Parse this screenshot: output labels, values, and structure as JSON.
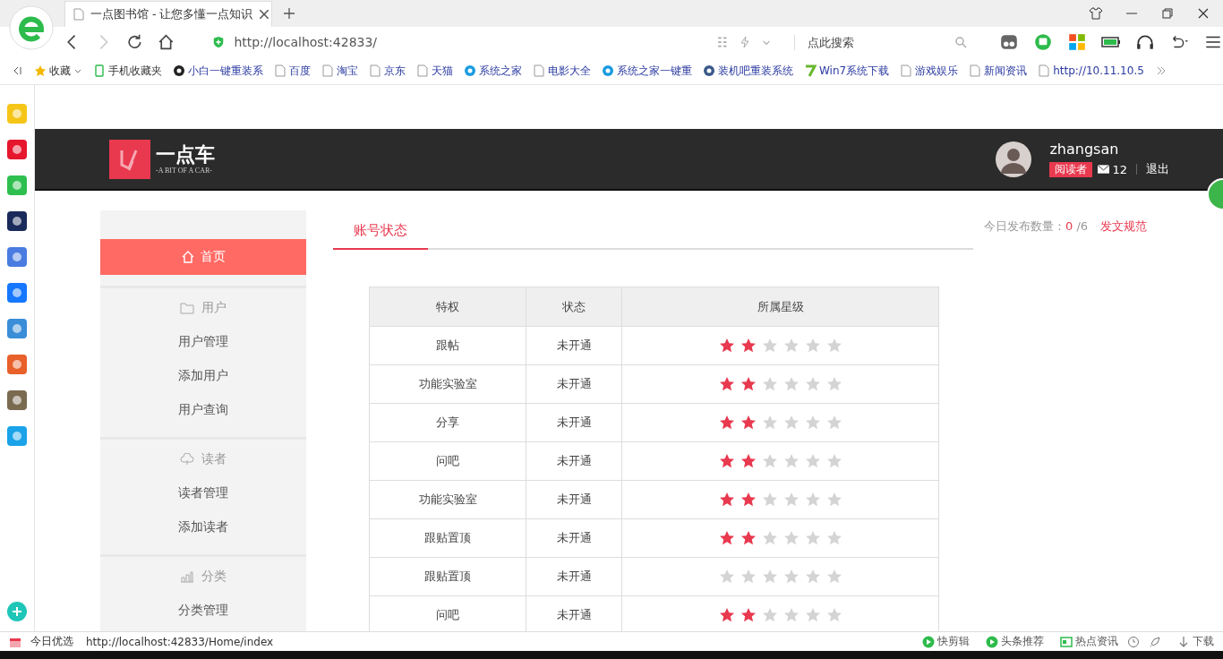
{
  "browser": {
    "tab": {
      "title": "一点图书馆 - 让您多懂一点知识"
    },
    "address": "http://localhost:42833/",
    "search": {
      "placeholder": "点此搜索"
    },
    "bookmarks": [
      {
        "label": "收藏",
        "kind": "star"
      },
      {
        "label": "手机收藏夹",
        "kind": "phone"
      },
      {
        "label": "小白一键重装系",
        "kind": "site"
      },
      {
        "label": "百度",
        "kind": "page"
      },
      {
        "label": "淘宝",
        "kind": "page"
      },
      {
        "label": "京东",
        "kind": "page"
      },
      {
        "label": "天猫",
        "kind": "page"
      },
      {
        "label": "系统之家",
        "kind": "site"
      },
      {
        "label": "电影大全",
        "kind": "page"
      },
      {
        "label": "系统之家一键重",
        "kind": "site"
      },
      {
        "label": "装机吧重装系统",
        "kind": "site"
      },
      {
        "label": "Win7系统下载",
        "kind": "seven"
      },
      {
        "label": "游戏娱乐",
        "kind": "page"
      },
      {
        "label": "新闻资讯",
        "kind": "page"
      },
      {
        "label": "http://10.11.10.5",
        "kind": "page"
      }
    ]
  },
  "site": {
    "logo": {
      "name": "一点车",
      "tagline": "-A BIT OF A CAR-"
    },
    "user": {
      "name": "zhangsan",
      "role": "阅读者",
      "messages": "12",
      "logout": "退出"
    }
  },
  "sidebar": {
    "home": {
      "label": "首页",
      "selected": true
    },
    "groups": [
      {
        "title": "用户",
        "kind": "folder",
        "items": [
          "用户管理",
          "添加用户",
          "用户查询"
        ]
      },
      {
        "title": "读者",
        "kind": "reader",
        "items": [
          "读者管理",
          "添加读者"
        ]
      },
      {
        "title": "分类",
        "kind": "chart",
        "items": [
          "分类管理"
        ]
      }
    ]
  },
  "tabs": [
    {
      "label": "账号状态",
      "selected": true
    }
  ],
  "publish": {
    "label": "今日发布数量：",
    "count": "0",
    "total": "/6",
    "rules_link": "发文规范"
  },
  "table": {
    "columns": [
      "特权",
      "状态",
      "所属星级"
    ],
    "rows": [
      {
        "privilege": "跟帖",
        "status": "未开通",
        "stars": 2
      },
      {
        "privilege": "功能实验室",
        "status": "未开通",
        "stars": 2
      },
      {
        "privilege": "分享",
        "status": "未开通",
        "stars": 2
      },
      {
        "privilege": "问吧",
        "status": "未开通",
        "stars": 2
      },
      {
        "privilege": "功能实验室",
        "status": "未开通",
        "stars": 2
      },
      {
        "privilege": "跟贴置顶",
        "status": "未开通",
        "stars": 2
      },
      {
        "privilege": "跟贴置顶",
        "status": "未开通",
        "stars": 0
      },
      {
        "privilege": "问吧",
        "status": "未开通",
        "stars": 2
      }
    ]
  },
  "status_bar": {
    "label": "今日优选",
    "url": "http://localhost:42833/Home/index",
    "items": [
      {
        "label": "快剪辑",
        "kind": "green"
      },
      {
        "label": "头条推荐",
        "kind": "green"
      },
      {
        "label": "热点资讯",
        "kind": "news"
      },
      {
        "label": "下载",
        "kind": "download"
      }
    ]
  }
}
